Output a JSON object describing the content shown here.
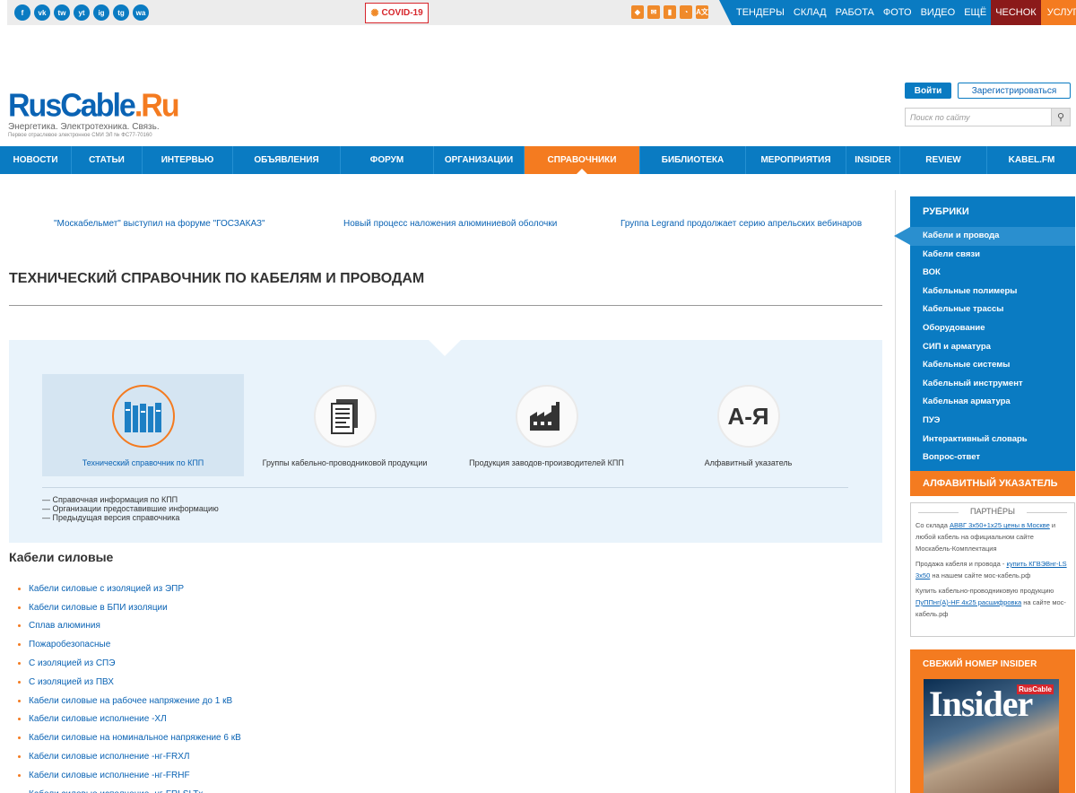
{
  "topbar": {
    "social": [
      "f",
      "vk",
      "tw",
      "yt",
      "ig",
      "tg",
      "wa"
    ],
    "covid": "COVID-19",
    "icons": [
      "shield-icon",
      "mail-icon",
      "mobile-icon",
      "rss-icon",
      "translate-icon"
    ],
    "translate_label": "A文",
    "nav": [
      "ТЕНДЕРЫ",
      "СКЛАД",
      "РАБОТА",
      "ФОТО",
      "ВИДЕО",
      "ЕЩЁ"
    ],
    "chesnok": "ЧЕСНОК",
    "uslugi": "УСЛУГИ"
  },
  "header": {
    "brand_a": "RusCable",
    "brand_b": ".Ru",
    "tagline": "Энергетика. Электротехника. Связь.",
    "subline": "Первое отраслевое электронное СМИ ЭЛ № ФС77-70160",
    "login": "Войти",
    "register": "Зарегистрироваться",
    "search_placeholder": "Поиск по сайту"
  },
  "mainnav": [
    "НОВОСТИ",
    "СТАТЬИ",
    "ИНТЕРВЬЮ",
    "ОБЪЯВЛЕНИЯ",
    "ФОРУМ",
    "ОРГАНИЗАЦИИ",
    "СПРАВОЧНИКИ",
    "БИБЛИОТЕКА",
    "МЕРОПРИЯТИЯ",
    "INSIDER",
    "REVIEW",
    "KABEL.FM"
  ],
  "news": [
    "\"Москабельмет\" выступил на форуме \"ГОСЗАКАЗ\"",
    "Новый процесс наложения алюминиевой оболочки",
    "Группа Legrand продолжает серию апрельских вебинаров"
  ],
  "page_title": "ТЕХНИЧЕСКИЙ СПРАВОЧНИК ПО КАБЕЛЯМ И ПРОВОДАМ",
  "panel": {
    "cells": [
      "Технический справочник по КПП",
      "Группы кабельно-проводниковой продукции",
      "Продукция заводов-производителей КПП",
      "Алфавитный указатель"
    ],
    "alpha_glyph": "А-Я",
    "links": [
      "— Справочная информация по КПП",
      "— Организации предоставившие информацию",
      "— Предыдущая версия справочника"
    ]
  },
  "section_title": "Кабели силовые",
  "cables": [
    "Кабели силовые с изоляцией из ЭПР",
    "Кабели силовые в БПИ изоляции",
    "Сплав алюминия",
    "Пожаробезопасные",
    "С изоляцией из СПЭ",
    "С изоляцией из ПВХ",
    "Кабели силовые на рабочее напряжение до 1 кВ",
    "Кабели силовые исполнение -ХЛ",
    "Кабели силовые на номинальное напряжение 6 кВ",
    "Кабели силовые исполнение -нг-FRХЛ",
    "Кабели силовые исполнение -нг-FRHF",
    "Кабели силовые исполнение -нг-FRLSLTx"
  ],
  "sidebar": {
    "rubrics_title": "РУБРИКИ",
    "rubrics": [
      "Кабели и провода",
      "Кабели связи",
      "ВОК",
      "Кабельные полимеры",
      "Кабельные трассы",
      "Оборудование",
      "СИП и арматура",
      "Кабельные системы",
      "Кабельный инструмент",
      "Кабельная арматура",
      "ПУЭ",
      "Интерактивный словарь",
      "Вопрос-ответ"
    ],
    "alpha_title": "АЛФАВИТНЫЙ УКАЗАТЕЛЬ",
    "partners_title": "ПАРТНЁРЫ",
    "partners": [
      {
        "pre": "Со склада ",
        "link": "АВВГ 3х50+1х25 цены в Москве",
        "post": " и любой кабель на официальном сайте Москабель-Комплектация"
      },
      {
        "pre": "Продажа кабеля и провода - ",
        "link": "купить КГВЭВнг-LS 3х50",
        "post": " на нашем сайте мос-кабель.рф"
      },
      {
        "pre": "Купить кабельно-проводниковую продукцию ",
        "link": "ПуППнг(А)-HF 4х25 расшифровка",
        "post": " на сайте мос-кабель.рф"
      }
    ],
    "insider_title": "СВЕЖИЙ НОМЕР INSIDER",
    "insider_mag": "Insider",
    "insider_badge": "RusCable"
  }
}
